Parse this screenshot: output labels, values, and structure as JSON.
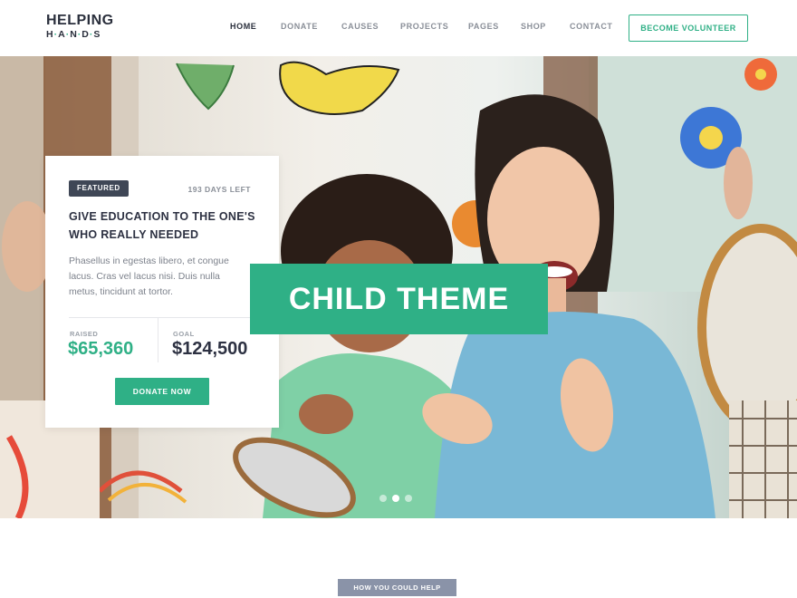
{
  "logo": {
    "top": "HELPING",
    "bottom": [
      "H",
      "A",
      "N",
      "D",
      "S"
    ]
  },
  "nav": {
    "items": [
      "HOME",
      "DONATE",
      "CAUSES",
      "PROJECTS",
      "PAGES",
      "SHOP",
      "CONTACT"
    ],
    "active": "HOME",
    "cta": "BECOME VOLUNTEER"
  },
  "card": {
    "badge": "FEATURED",
    "days_left": "193 DAYS LEFT",
    "title": "GIVE EDUCATION TO THE ONE'S WHO REALLY NEEDED",
    "description": "Phasellus in egestas libero, et congue lacus. Cras vel lacus nisi. Duis nulla metus, tincidunt at tortor.",
    "raised_label": "RAISED",
    "raised_value": "$65,360",
    "goal_label": "GOAL",
    "goal_value": "$124,500",
    "button": "DONATE NOW"
  },
  "banner": {
    "text": "CHILD THEME"
  },
  "slider": {
    "total": 3,
    "active_index": 1
  },
  "section": {
    "badge": "HOW YOU COULD HELP"
  },
  "colors": {
    "accent": "#2fb086",
    "dark": "#2d3142",
    "badge": "#3f4756",
    "section_badge": "#8a93a8"
  }
}
